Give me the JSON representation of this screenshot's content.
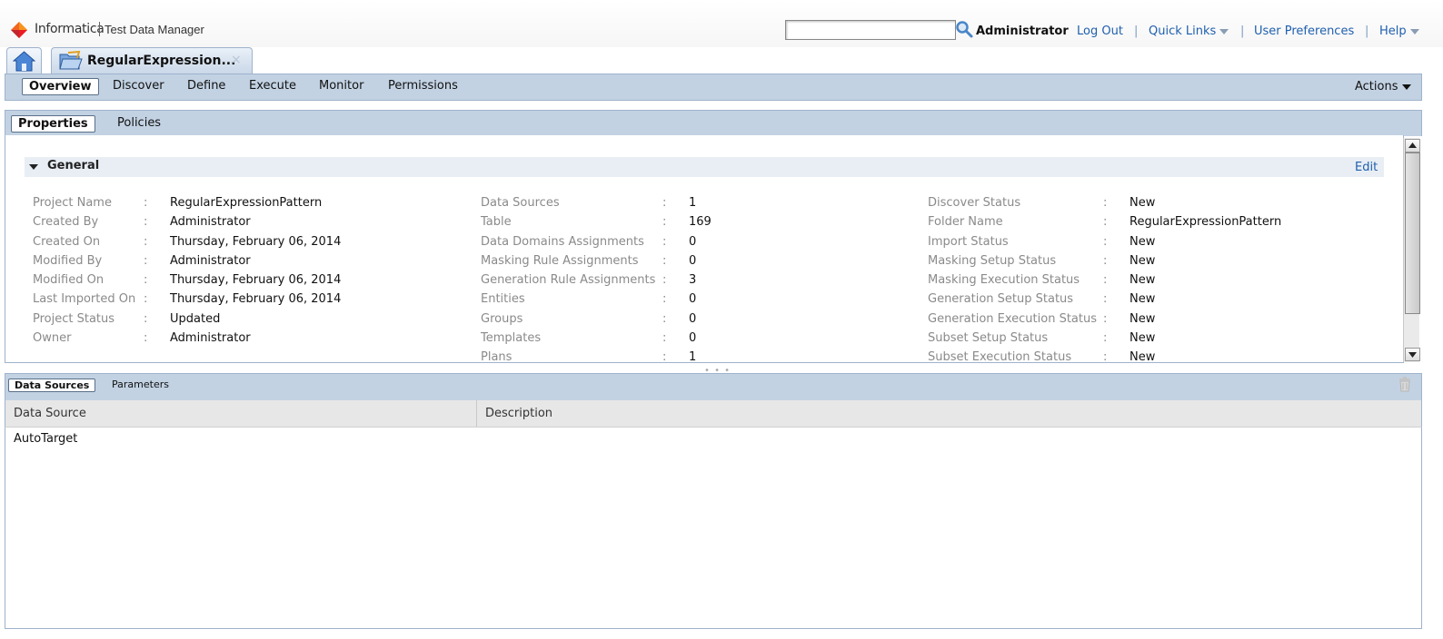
{
  "header": {
    "brand": "Informatica",
    "product": "Test Data Manager",
    "search_value": "",
    "user": "Administrator",
    "links": {
      "logout": "Log Out",
      "quick_links": "Quick Links",
      "user_prefs": "User Preferences",
      "help": "Help"
    },
    "separator": "|"
  },
  "tabs": {
    "home_icon": "home-icon",
    "doc_icon": "open-folder-icon",
    "doc_title": "RegularExpression...",
    "close": "×"
  },
  "main_nav": {
    "items": [
      "Overview",
      "Discover",
      "Define",
      "Execute",
      "Monitor",
      "Permissions"
    ],
    "selected": "Overview",
    "actions": "Actions"
  },
  "properties_panel": {
    "tabs": [
      "Properties",
      "Policies"
    ],
    "selected": "Properties",
    "section_title": "General",
    "edit": "Edit",
    "colon": ":",
    "col1": [
      {
        "label": "Project Name",
        "value": "RegularExpressionPattern"
      },
      {
        "label": "Created By",
        "value": "Administrator"
      },
      {
        "label": "Created On",
        "value": "Thursday, February 06, 2014"
      },
      {
        "label": "Modified By",
        "value": "Administrator"
      },
      {
        "label": "Modified On",
        "value": "Thursday, February 06, 2014"
      },
      {
        "label": "Last Imported On",
        "value": "Thursday, February 06, 2014"
      },
      {
        "label": "Project Status",
        "value": "Updated"
      },
      {
        "label": "Owner",
        "value": "Administrator"
      }
    ],
    "col2": [
      {
        "label": "Data Sources",
        "value": "1"
      },
      {
        "label": "Table",
        "value": "169"
      },
      {
        "label": "Data Domains Assignments",
        "value": "0"
      },
      {
        "label": "Masking Rule Assignments",
        "value": "0"
      },
      {
        "label": "Generation Rule Assignments",
        "value": "3"
      },
      {
        "label": "Entities",
        "value": "0"
      },
      {
        "label": "Groups",
        "value": "0"
      },
      {
        "label": "Templates",
        "value": "0"
      },
      {
        "label": "Plans",
        "value": "1"
      }
    ],
    "col3": [
      {
        "label": "Discover Status",
        "value": "New"
      },
      {
        "label": "Folder Name",
        "value": "RegularExpressionPattern"
      },
      {
        "label": "Import Status",
        "value": "New"
      },
      {
        "label": "Masking Setup Status",
        "value": "New"
      },
      {
        "label": "Masking Execution Status",
        "value": "New"
      },
      {
        "label": "Generation Setup Status",
        "value": "New"
      },
      {
        "label": "Generation Execution Status",
        "value": "New"
      },
      {
        "label": "Subset Setup Status",
        "value": "New"
      },
      {
        "label": "Subset Execution Status",
        "value": "New"
      }
    ]
  },
  "bottom_panel": {
    "tabs": [
      "Data Sources",
      "Parameters"
    ],
    "selected": "Data Sources",
    "trash_icon": "trash-icon",
    "columns": [
      "Data Source",
      "Description"
    ],
    "rows": [
      {
        "data_source": "AutoTarget",
        "description": ""
      }
    ]
  },
  "colors": {
    "nav_bg": "#c2d2e3",
    "link": "#1f5fae",
    "label_gray": "#8a8a8a",
    "brand_orange": "#f26522"
  }
}
